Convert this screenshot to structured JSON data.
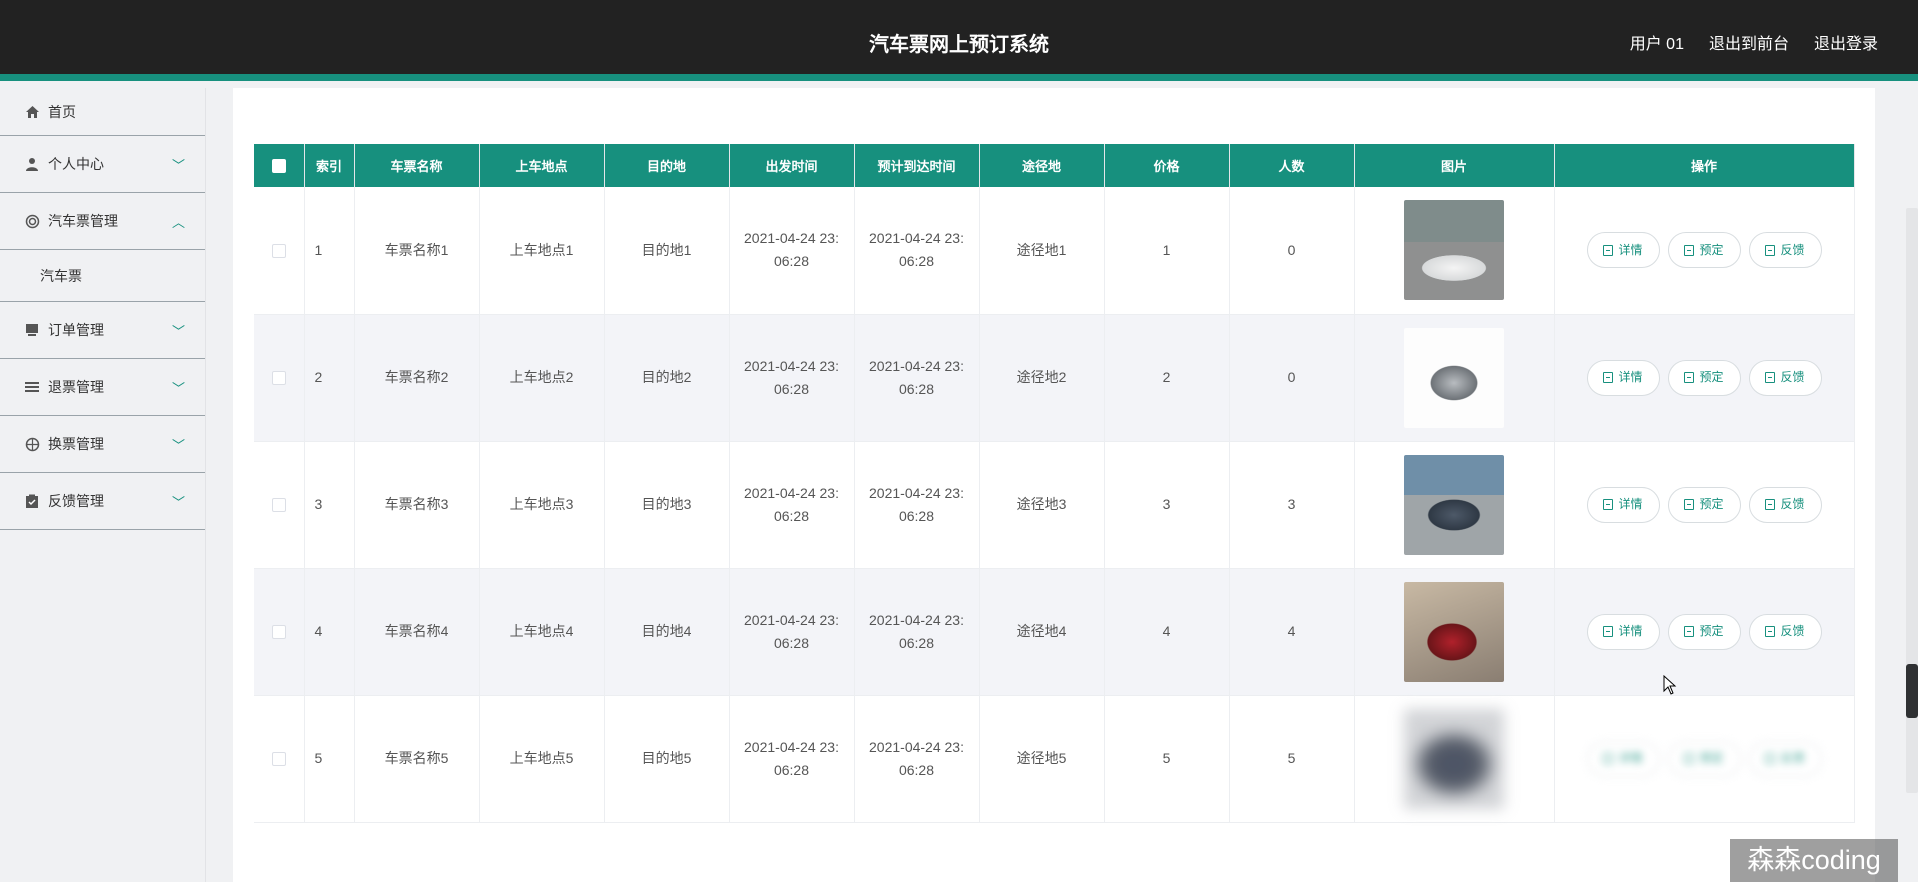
{
  "header": {
    "app_title": "汽车票网上预订系统",
    "user_label": "用户 01",
    "back_frontend": "退出到前台",
    "logout": "退出登录"
  },
  "sidebar": {
    "items": [
      {
        "label": "首页",
        "icon": "home-icon"
      },
      {
        "label": "个人中心",
        "icon": "user-icon"
      },
      {
        "label": "汽车票管理",
        "icon": "circle-icon",
        "expanded": true,
        "sub": [
          "汽车票"
        ]
      },
      {
        "label": "订单管理",
        "icon": "order-icon"
      },
      {
        "label": "退票管理",
        "icon": "list-icon"
      },
      {
        "label": "换票管理",
        "icon": "compass-icon"
      },
      {
        "label": "反馈管理",
        "icon": "clipboard-icon"
      }
    ]
  },
  "table": {
    "headers": [
      "索引",
      "车票名称",
      "上车地点",
      "目的地",
      "出发时间",
      "预计到达时间",
      "途径地",
      "价格",
      "人数",
      "图片",
      "操作"
    ],
    "rows": [
      {
        "index": "1",
        "name": "车票名称1",
        "boarding": "上车地点1",
        "destination": "目的地1",
        "depart_line1": "2021-04-24 23:",
        "depart_line2": "06:28",
        "arrive_line1": "2021-04-24 23:",
        "arrive_line2": "06:28",
        "via": "途径地1",
        "price": "1",
        "count": "0"
      },
      {
        "index": "2",
        "name": "车票名称2",
        "boarding": "上车地点2",
        "destination": "目的地2",
        "depart_line1": "2021-04-24 23:",
        "depart_line2": "06:28",
        "arrive_line1": "2021-04-24 23:",
        "arrive_line2": "06:28",
        "via": "途径地2",
        "price": "2",
        "count": "0"
      },
      {
        "index": "3",
        "name": "车票名称3",
        "boarding": "上车地点3",
        "destination": "目的地3",
        "depart_line1": "2021-04-24 23:",
        "depart_line2": "06:28",
        "arrive_line1": "2021-04-24 23:",
        "arrive_line2": "06:28",
        "via": "途径地3",
        "price": "3",
        "count": "3"
      },
      {
        "index": "4",
        "name": "车票名称4",
        "boarding": "上车地点4",
        "destination": "目的地4",
        "depart_line1": "2021-04-24 23:",
        "depart_line2": "06:28",
        "arrive_line1": "2021-04-24 23:",
        "arrive_line2": "06:28",
        "via": "途径地4",
        "price": "4",
        "count": "4"
      },
      {
        "index": "5",
        "name": "车票名称5",
        "boarding": "上车地点5",
        "destination": "目的地5",
        "depart_line1": "2021-04-24 23:",
        "depart_line2": "06:28",
        "arrive_line1": "2021-04-24 23:",
        "arrive_line2": "06:28",
        "via": "途径地5",
        "price": "5",
        "count": "5"
      }
    ],
    "actions": {
      "detail": "详情",
      "book": "预定",
      "feedback": "反馈"
    }
  },
  "watermark": "森森coding",
  "colors": {
    "accent": "#17907e",
    "header_bg": "#222222"
  }
}
